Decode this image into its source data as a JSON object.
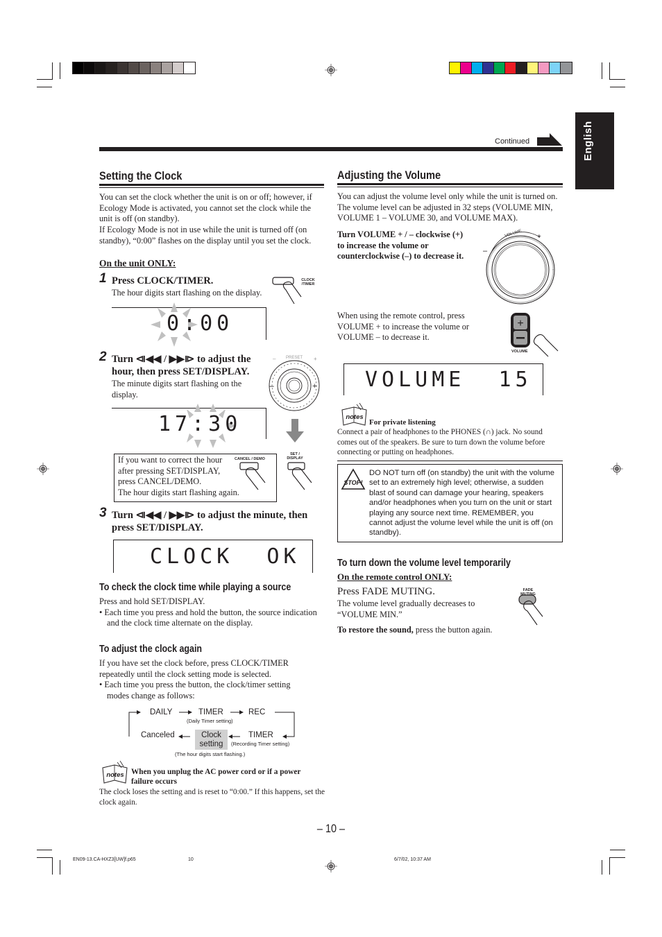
{
  "header": {
    "continued_label": "Continued",
    "language_tab": "English",
    "gray_bars": [
      "#000000",
      "#0c0a0a",
      "#1a1716",
      "#272220",
      "#3b3432",
      "#524a47",
      "#6b625f",
      "#8a817e",
      "#aaa2a0",
      "#d3cccb",
      "#ffffff"
    ],
    "color_bars": [
      "#fff200",
      "#ec008c",
      "#00aeef",
      "#2e3192",
      "#00a651",
      "#ed1c24",
      "#231f20",
      "#fff57a",
      "#f49ac1",
      "#7dd3f7",
      "#939598"
    ]
  },
  "left": {
    "title": "Setting the Clock",
    "intro": [
      "You can set the clock whether the unit is on or off; however, if Ecology Mode is activated, you cannot set the clock while the unit is off (on standby).",
      "If Ecology Mode is not in use while the unit is turned off (on standby), “0:00” flashes on the display until you set the clock."
    ],
    "unit_only": "On the unit ONLY:",
    "steps": [
      {
        "num": "1",
        "heading": "Press CLOCK/TIMER.",
        "desc": "The hour digits start flashing on the display.",
        "button_label": "CLOCK /TIMER",
        "display": "0:00"
      },
      {
        "num": "2",
        "heading_line1": "Turn ⧏◀◀ / ▶▶⧐ to adjust the",
        "heading_line2": "hour, then press SET/DISPLAY.",
        "desc": "The minute digits start flashing on the display.",
        "dial_label": "PRESET",
        "display": "17:30"
      },
      {
        "num": "3",
        "heading_line1": "Turn ⧏◀◀ / ▶▶⧐ to adjust the minute, then",
        "heading_line2": "press SET/DISPLAY.",
        "display": "CLOCK  OK"
      }
    ],
    "correct_box": {
      "lines": [
        "If you want to correct the hour",
        "after pressing SET/DISPLAY,",
        "press CANCEL/DEMO.",
        "The hour digits start flashing again."
      ],
      "cancel_label": "CANCEL / DEMO",
      "set_label": "SET / DISPLAY"
    },
    "check_clock": {
      "title": "To check the clock time while playing a source",
      "line": "Press and hold SET/DISPLAY.",
      "bullet": "Each time you press and hold the button, the source indication and the clock time alternate on the display."
    },
    "adjust_again": {
      "title": "To adjust the clock again",
      "line": "If you have set the clock before, press CLOCK/TIMER repeatedly until the clock setting mode is selected.",
      "bullet": "Each time you press the button, the clock/timer setting modes change as follows:"
    },
    "flow": {
      "daily": "DAILY",
      "timer1": "TIMER",
      "timer1_sub": "(Daily Timer setting)",
      "rec": "REC",
      "timer2": "TIMER",
      "timer2_sub": "(Recording Timer setting)",
      "clock_setting_1": "Clock",
      "clock_setting_2": "setting",
      "clock_sub": "(The hour digits start flashing.)",
      "canceled": "Canceled"
    },
    "note": {
      "icon_label": "notes",
      "title": "When you unplug the AC power cord or if a power failure occurs",
      "text": "The clock loses the setting and is reset to “0:00.” If this happens, set the clock again."
    }
  },
  "right": {
    "title": "Adjusting the Volume",
    "intro": "You can adjust the volume level only while the unit is turned on. The volume level can be adjusted in 32 steps (VOLUME MIN, VOLUME 1 – VOLUME 30, and VOLUME MAX).",
    "turn_instruction": [
      "Turn VOLUME + / – clockwise (+)",
      "to increase the volume or",
      "counterclockwise (–) to decrease it."
    ],
    "knob_label": "VOLUME",
    "knob_minus": "–",
    "knob_plus": "+",
    "remote_text": [
      "When using the remote control, press",
      "VOLUME + to increase the volume or",
      "VOLUME – to decrease it."
    ],
    "remote_button_label": "VOLUME",
    "display": "VOLUME  15",
    "note": {
      "icon_label": "notes",
      "title": "For private listening",
      "text": "Connect a pair of headphones to the PHONES (∩) jack. No sound comes out of the speakers. Be sure to turn down the volume before connecting or putting on headphones."
    },
    "warning": {
      "icon_label": "STOP!",
      "text": "DO NOT turn off (on standby) the unit with the volume set to an extremely high level; otherwise, a sudden blast of sound can damage your hearing, speakers and/or headphones when you turn on the unit or start playing any source next time. REMEMBER, you cannot adjust the volume level while the unit is off (on standby)."
    },
    "temp_down": {
      "title": "To turn down the volume level temporarily",
      "remote_only": "On the remote control ONLY:",
      "heading": "Press FADE MUTING.",
      "desc": [
        "The volume level gradually decreases to",
        "“VOLUME MIN.”"
      ],
      "button_label": "FADE MUTING",
      "restore_bold": "To restore the sound,",
      "restore_rest": " press the button again."
    }
  },
  "footer": {
    "page_number": "– 10 –",
    "file": "EN09-13.CA-HXZ3[UW]f.p65",
    "file_page": "10",
    "timestamp": "6/7/02, 10:37 AM"
  }
}
